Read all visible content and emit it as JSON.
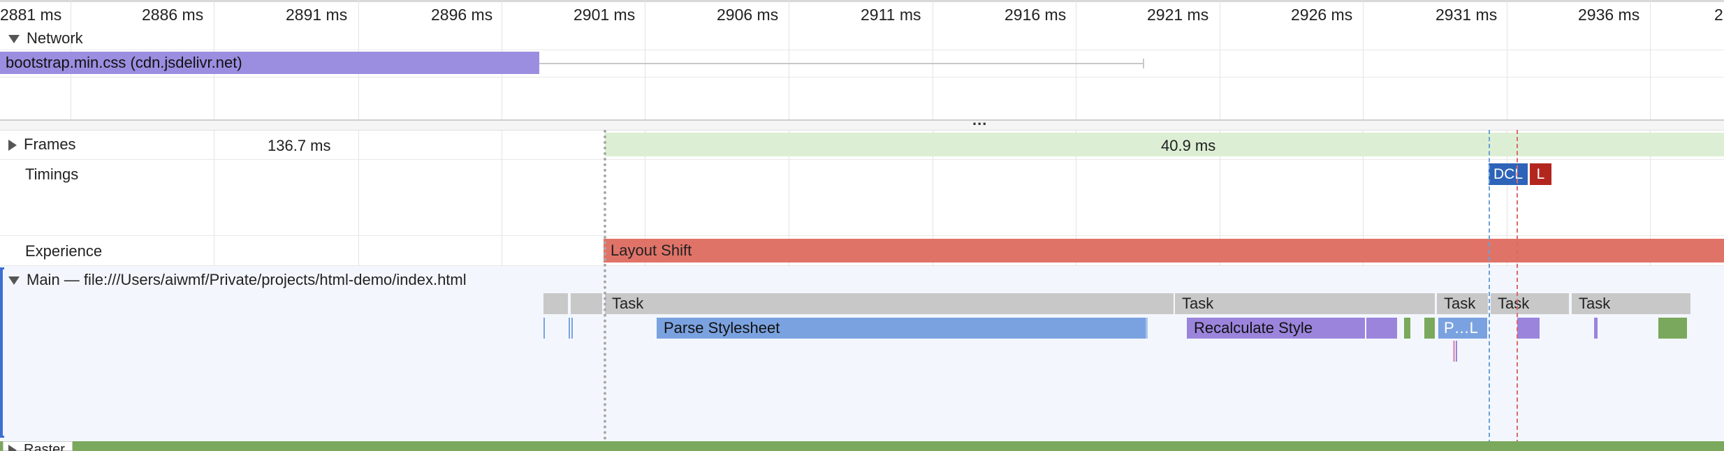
{
  "ruler": {
    "ticks": [
      "2881 ms",
      "2886 ms",
      "2891 ms",
      "2896 ms",
      "2901 ms",
      "2906 ms",
      "2911 ms",
      "2916 ms",
      "2921 ms",
      "2926 ms",
      "2931 ms",
      "2936 ms",
      "2"
    ]
  },
  "network": {
    "label": "Network",
    "request": "bootstrap.min.css (cdn.jsdelivr.net)"
  },
  "divider": {
    "handle": "..."
  },
  "frames": {
    "label": "Frames",
    "frame1": "136.7 ms",
    "frame2": "40.9 ms"
  },
  "timings": {
    "label": "Timings",
    "dcl": "DCL",
    "load": "L"
  },
  "experience": {
    "label": "Experience",
    "layout_shift": "Layout Shift"
  },
  "main": {
    "label": "Main — file:///Users/aiwmf/Private/projects/html-demo/index.html",
    "tasks": [
      "Task",
      "Task",
      "Task",
      "Task",
      "Task"
    ],
    "parse_stylesheet": "Parse Stylesheet",
    "recalculate_style": "Recalculate Style",
    "parse_short": "P…L"
  },
  "raster": {
    "label": "Raster"
  },
  "colors": {
    "network_bar": "#9b8ee0",
    "frame_green": "#dcefd4",
    "dcl_blue": "#2d63b8",
    "load_red": "#b3261e",
    "layout_shift": "#e07368",
    "task_gray": "#c8c8c8",
    "parse_blue": "#7ba2e0",
    "recalc_purple": "#9b84dc",
    "main_bg": "#f3f7fd",
    "raster_green": "#7aa85c"
  }
}
